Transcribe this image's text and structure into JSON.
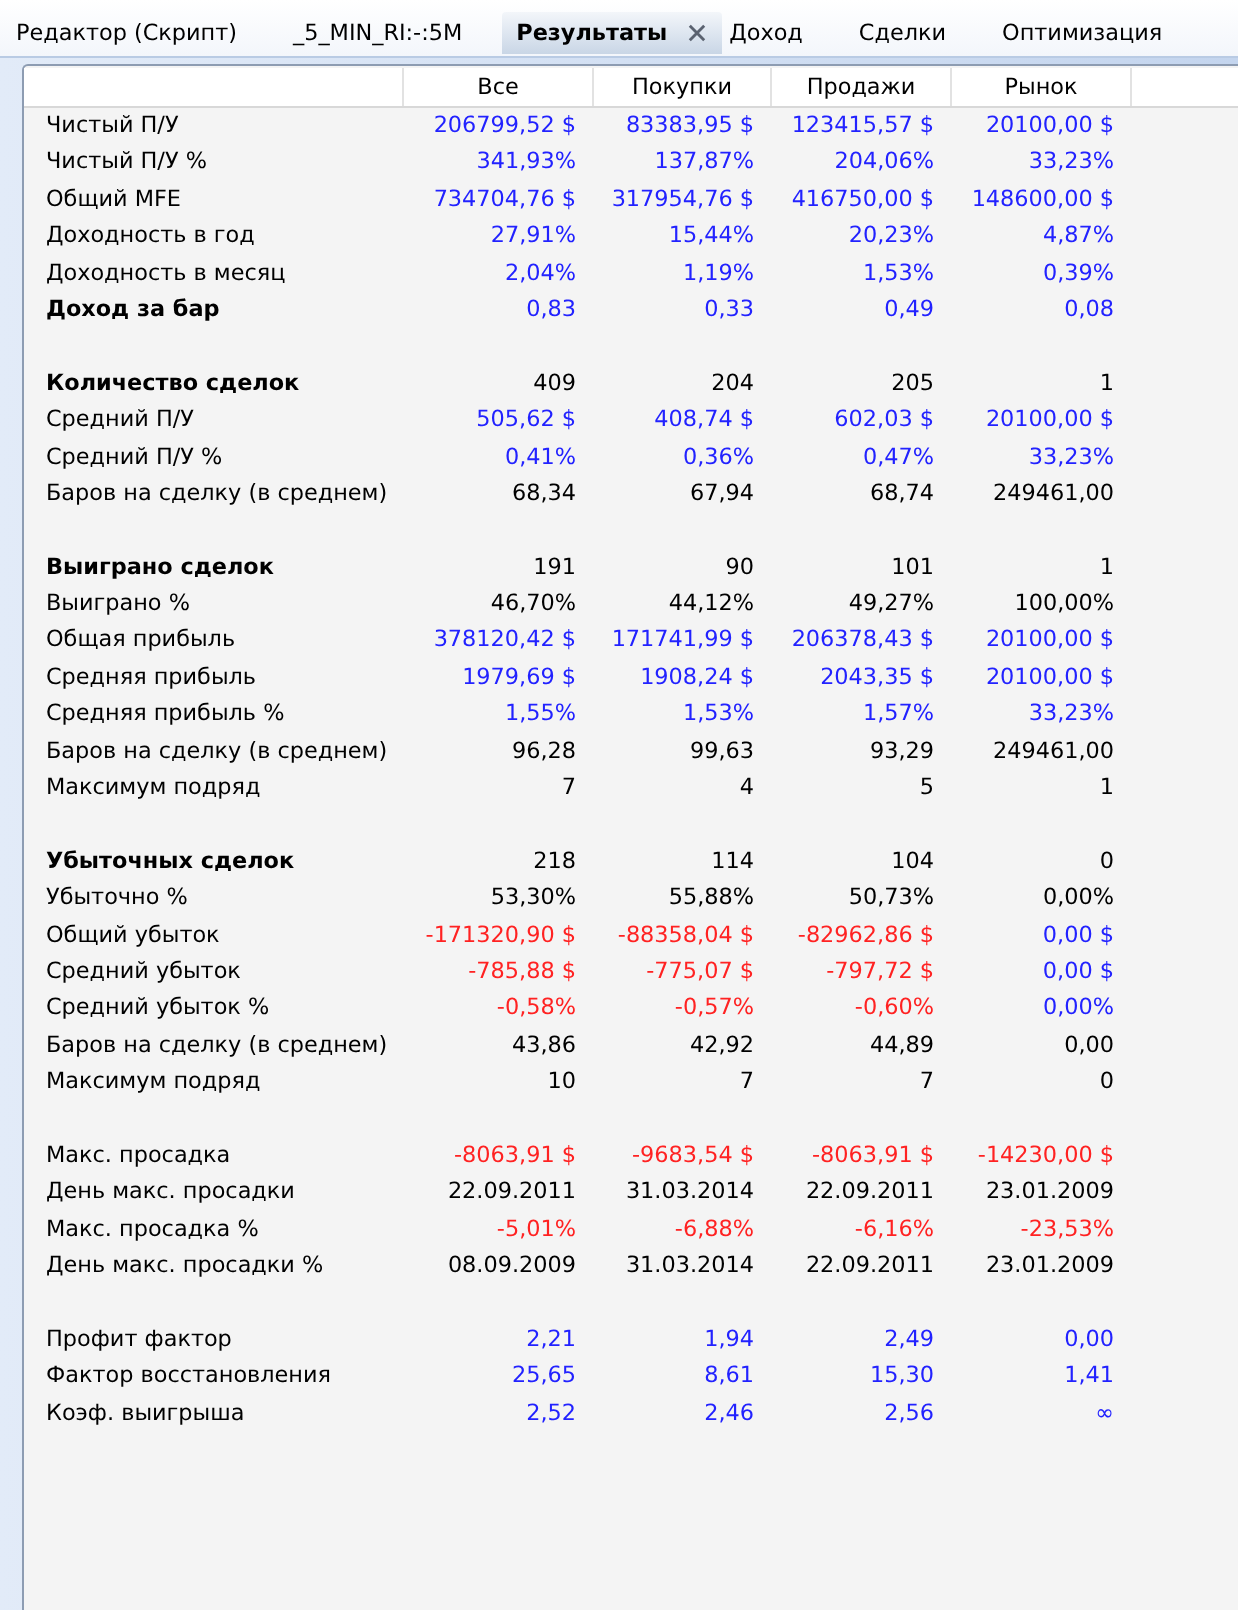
{
  "tabs": [
    {
      "label": "Редактор (Скрипт)",
      "selected": false
    },
    {
      "label": "_5_MIN_RI:-:5M",
      "selected": false
    },
    {
      "label": "Результаты",
      "selected": true
    },
    {
      "label": "Доход",
      "selected": false
    },
    {
      "label": "Сделки",
      "selected": false
    },
    {
      "label": "Оптимизация",
      "selected": false
    }
  ],
  "table": {
    "columns": [
      "Все",
      "Покупки",
      "Продажи",
      "Рынок"
    ],
    "sections": [
      {
        "rows": [
          {
            "label": "Чистый П/У",
            "bold": false,
            "values": [
              {
                "text": "206799,52 $",
                "color": "#2222ff"
              },
              {
                "text": "83383,95 $",
                "color": "#2222ff"
              },
              {
                "text": "123415,57 $",
                "color": "#2222ff"
              },
              {
                "text": "20100,00 $",
                "color": "#2222ff"
              }
            ]
          },
          {
            "label": "Чистый П/У %",
            "bold": false,
            "values": [
              {
                "text": "341,93%",
                "color": "#2222ff"
              },
              {
                "text": "137,87%",
                "color": "#2222ff"
              },
              {
                "text": "204,06%",
                "color": "#2222ff"
              },
              {
                "text": "33,23%",
                "color": "#2222ff"
              }
            ]
          },
          {
            "label": "Общий MFE",
            "bold": false,
            "values": [
              {
                "text": "734704,76 $",
                "color": "#2222ff"
              },
              {
                "text": "317954,76 $",
                "color": "#2222ff"
              },
              {
                "text": "416750,00 $",
                "color": "#2222ff"
              },
              {
                "text": "148600,00 $",
                "color": "#2222ff"
              }
            ]
          },
          {
            "label": "Доходность в год",
            "bold": false,
            "values": [
              {
                "text": "27,91%",
                "color": "#2222ff"
              },
              {
                "text": "15,44%",
                "color": "#2222ff"
              },
              {
                "text": "20,23%",
                "color": "#2222ff"
              },
              {
                "text": "4,87%",
                "color": "#2222ff"
              }
            ]
          },
          {
            "label": "Доходность в месяц",
            "bold": false,
            "values": [
              {
                "text": "2,04%",
                "color": "#2222ff"
              },
              {
                "text": "1,19%",
                "color": "#2222ff"
              },
              {
                "text": "1,53%",
                "color": "#2222ff"
              },
              {
                "text": "0,39%",
                "color": "#2222ff"
              }
            ]
          },
          {
            "label": "Доход за бар",
            "bold": true,
            "values": [
              {
                "text": "0,83",
                "color": "#2222ff"
              },
              {
                "text": "0,33",
                "color": "#2222ff"
              },
              {
                "text": "0,49",
                "color": "#2222ff"
              },
              {
                "text": "0,08",
                "color": "#2222ff"
              }
            ]
          }
        ]
      },
      {
        "rows": [
          {
            "label": "Количество сделок",
            "bold": true,
            "values": [
              {
                "text": "409",
                "color": "#000000"
              },
              {
                "text": "204",
                "color": "#000000"
              },
              {
                "text": "205",
                "color": "#000000"
              },
              {
                "text": "1",
                "color": "#000000"
              }
            ]
          },
          {
            "label": "Средний П/У",
            "bold": false,
            "values": [
              {
                "text": "505,62 $",
                "color": "#2222ff"
              },
              {
                "text": "408,74 $",
                "color": "#2222ff"
              },
              {
                "text": "602,03 $",
                "color": "#2222ff"
              },
              {
                "text": "20100,00 $",
                "color": "#2222ff"
              }
            ]
          },
          {
            "label": "Средний П/У %",
            "bold": false,
            "values": [
              {
                "text": "0,41%",
                "color": "#2222ff"
              },
              {
                "text": "0,36%",
                "color": "#2222ff"
              },
              {
                "text": "0,47%",
                "color": "#2222ff"
              },
              {
                "text": "33,23%",
                "color": "#2222ff"
              }
            ]
          },
          {
            "label": "Баров на сделку (в среднем)",
            "bold": false,
            "values": [
              {
                "text": "68,34",
                "color": "#000000"
              },
              {
                "text": "67,94",
                "color": "#000000"
              },
              {
                "text": "68,74",
                "color": "#000000"
              },
              {
                "text": "249461,00",
                "color": "#000000"
              }
            ]
          }
        ]
      },
      {
        "rows": [
          {
            "label": "Выиграно сделок",
            "bold": true,
            "values": [
              {
                "text": "191",
                "color": "#000000"
              },
              {
                "text": "90",
                "color": "#000000"
              },
              {
                "text": "101",
                "color": "#000000"
              },
              {
                "text": "1",
                "color": "#000000"
              }
            ]
          },
          {
            "label": "Выиграно %",
            "bold": false,
            "values": [
              {
                "text": "46,70%",
                "color": "#000000"
              },
              {
                "text": "44,12%",
                "color": "#000000"
              },
              {
                "text": "49,27%",
                "color": "#000000"
              },
              {
                "text": "100,00%",
                "color": "#000000"
              }
            ]
          },
          {
            "label": "Общая прибыль",
            "bold": false,
            "values": [
              {
                "text": "378120,42 $",
                "color": "#2222ff"
              },
              {
                "text": "171741,99 $",
                "color": "#2222ff"
              },
              {
                "text": "206378,43 $",
                "color": "#2222ff"
              },
              {
                "text": "20100,00 $",
                "color": "#2222ff"
              }
            ]
          },
          {
            "label": "Средняя прибыль",
            "bold": false,
            "values": [
              {
                "text": "1979,69 $",
                "color": "#2222ff"
              },
              {
                "text": "1908,24 $",
                "color": "#2222ff"
              },
              {
                "text": "2043,35 $",
                "color": "#2222ff"
              },
              {
                "text": "20100,00 $",
                "color": "#2222ff"
              }
            ]
          },
          {
            "label": "Средняя прибыль %",
            "bold": false,
            "values": [
              {
                "text": "1,55%",
                "color": "#2222ff"
              },
              {
                "text": "1,53%",
                "color": "#2222ff"
              },
              {
                "text": "1,57%",
                "color": "#2222ff"
              },
              {
                "text": "33,23%",
                "color": "#2222ff"
              }
            ]
          },
          {
            "label": "Баров на сделку (в среднем)",
            "bold": false,
            "values": [
              {
                "text": "96,28",
                "color": "#000000"
              },
              {
                "text": "99,63",
                "color": "#000000"
              },
              {
                "text": "93,29",
                "color": "#000000"
              },
              {
                "text": "249461,00",
                "color": "#000000"
              }
            ]
          },
          {
            "label": "Максимум подряд",
            "bold": false,
            "values": [
              {
                "text": "7",
                "color": "#000000"
              },
              {
                "text": "4",
                "color": "#000000"
              },
              {
                "text": "5",
                "color": "#000000"
              },
              {
                "text": "1",
                "color": "#000000"
              }
            ]
          }
        ]
      },
      {
        "rows": [
          {
            "label": "Убыточных сделок",
            "bold": true,
            "values": [
              {
                "text": "218",
                "color": "#000000"
              },
              {
                "text": "114",
                "color": "#000000"
              },
              {
                "text": "104",
                "color": "#000000"
              },
              {
                "text": "0",
                "color": "#000000"
              }
            ]
          },
          {
            "label": "Убыточно %",
            "bold": false,
            "values": [
              {
                "text": "53,30%",
                "color": "#000000"
              },
              {
                "text": "55,88%",
                "color": "#000000"
              },
              {
                "text": "50,73%",
                "color": "#000000"
              },
              {
                "text": "0,00%",
                "color": "#000000"
              }
            ]
          },
          {
            "label": "Общий убыток",
            "bold": false,
            "values": [
              {
                "text": "-171320,90 $",
                "color": "#ff2222"
              },
              {
                "text": "-88358,04 $",
                "color": "#ff2222"
              },
              {
                "text": "-82962,86 $",
                "color": "#ff2222"
              },
              {
                "text": "0,00 $",
                "color": "#2222ff"
              }
            ]
          },
          {
            "label": "Средний убыток",
            "bold": false,
            "values": [
              {
                "text": "-785,88 $",
                "color": "#ff2222"
              },
              {
                "text": "-775,07 $",
                "color": "#ff2222"
              },
              {
                "text": "-797,72 $",
                "color": "#ff2222"
              },
              {
                "text": "0,00 $",
                "color": "#2222ff"
              }
            ]
          },
          {
            "label": "Средний убыток %",
            "bold": false,
            "values": [
              {
                "text": "-0,58%",
                "color": "#ff2222"
              },
              {
                "text": "-0,57%",
                "color": "#ff2222"
              },
              {
                "text": "-0,60%",
                "color": "#ff2222"
              },
              {
                "text": "0,00%",
                "color": "#2222ff"
              }
            ]
          },
          {
            "label": "Баров на сделку (в среднем)",
            "bold": false,
            "values": [
              {
                "text": "43,86",
                "color": "#000000"
              },
              {
                "text": "42,92",
                "color": "#000000"
              },
              {
                "text": "44,89",
                "color": "#000000"
              },
              {
                "text": "0,00",
                "color": "#000000"
              }
            ]
          },
          {
            "label": "Максимум подряд",
            "bold": false,
            "values": [
              {
                "text": "10",
                "color": "#000000"
              },
              {
                "text": "7",
                "color": "#000000"
              },
              {
                "text": "7",
                "color": "#000000"
              },
              {
                "text": "0",
                "color": "#000000"
              }
            ]
          }
        ]
      },
      {
        "rows": [
          {
            "label": "Макс. просадка",
            "bold": false,
            "values": [
              {
                "text": "-8063,91 $",
                "color": "#ff2222"
              },
              {
                "text": "-9683,54 $",
                "color": "#ff2222"
              },
              {
                "text": "-8063,91 $",
                "color": "#ff2222"
              },
              {
                "text": "-14230,00 $",
                "color": "#ff2222"
              }
            ]
          },
          {
            "label": "День макс. просадки",
            "bold": false,
            "values": [
              {
                "text": "22.09.2011",
                "color": "#000000"
              },
              {
                "text": "31.03.2014",
                "color": "#000000"
              },
              {
                "text": "22.09.2011",
                "color": "#000000"
              },
              {
                "text": "23.01.2009",
                "color": "#000000"
              }
            ]
          },
          {
            "label": "Макс. просадка %",
            "bold": false,
            "values": [
              {
                "text": "-5,01%",
                "color": "#ff2222"
              },
              {
                "text": "-6,88%",
                "color": "#ff2222"
              },
              {
                "text": "-6,16%",
                "color": "#ff2222"
              },
              {
                "text": "-23,53%",
                "color": "#ff2222"
              }
            ]
          },
          {
            "label": "День макс. просадки %",
            "bold": false,
            "values": [
              {
                "text": "08.09.2009",
                "color": "#000000"
              },
              {
                "text": "31.03.2014",
                "color": "#000000"
              },
              {
                "text": "22.09.2011",
                "color": "#000000"
              },
              {
                "text": "23.01.2009",
                "color": "#000000"
              }
            ]
          }
        ]
      },
      {
        "rows": [
          {
            "label": "Профит фактор",
            "bold": false,
            "values": [
              {
                "text": "2,21",
                "color": "#2222ff"
              },
              {
                "text": "1,94",
                "color": "#2222ff"
              },
              {
                "text": "2,49",
                "color": "#2222ff"
              },
              {
                "text": "0,00",
                "color": "#2222ff"
              }
            ]
          },
          {
            "label": "Фактор восстановления",
            "bold": false,
            "values": [
              {
                "text": "25,65",
                "color": "#2222ff"
              },
              {
                "text": "8,61",
                "color": "#2222ff"
              },
              {
                "text": "15,30",
                "color": "#2222ff"
              },
              {
                "text": "1,41",
                "color": "#2222ff"
              }
            ]
          },
          {
            "label": "Коэф. выигрыша",
            "bold": false,
            "values": [
              {
                "text": "2,52",
                "color": "#2222ff"
              },
              {
                "text": "2,46",
                "color": "#2222ff"
              },
              {
                "text": "2,56",
                "color": "#2222ff"
              },
              {
                "text": "∞",
                "color": "#2222ff"
              }
            ]
          }
        ]
      }
    ]
  }
}
